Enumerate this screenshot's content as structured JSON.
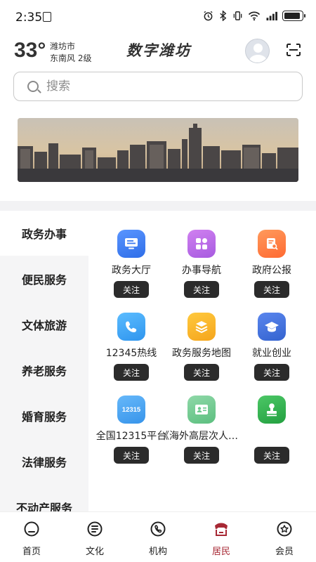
{
  "status_bar": {
    "time": "2:35"
  },
  "weather": {
    "temperature": "33°",
    "city": "潍坊市",
    "wind": "东南风  2级"
  },
  "app": {
    "title": "数字潍坊"
  },
  "search": {
    "placeholder": "搜索"
  },
  "sidebar": {
    "items": [
      {
        "label": "政务办事",
        "active": true
      },
      {
        "label": "便民服务"
      },
      {
        "label": "文体旅游"
      },
      {
        "label": "养老服务"
      },
      {
        "label": "婚育服务"
      },
      {
        "label": "法律服务"
      },
      {
        "label": "不动产服务"
      }
    ]
  },
  "services": [
    {
      "label": "政务大厅",
      "icon": "monitor-icon",
      "color": "#3d7cf0",
      "follow": "关注"
    },
    {
      "label": "办事导航",
      "icon": "apps-icon",
      "color": "#b768e6",
      "follow": "关注"
    },
    {
      "label": "政府公报",
      "icon": "document-search-icon",
      "color": "#ff7a3c",
      "follow": "关注"
    },
    {
      "label": "12345热线",
      "icon": "phone-icon",
      "color": "#39a4f5",
      "follow": "关注"
    },
    {
      "label": "政务服务地图",
      "icon": "layers-icon",
      "color": "#f7b52b",
      "follow": "关注"
    },
    {
      "label": "就业创业",
      "icon": "graduation-cap-icon",
      "color": "#3f6fd8",
      "follow": "关注"
    },
    {
      "label": "全国12315平台",
      "icon": "badge-12315-icon",
      "color": "#4aa7f0",
      "badge_text": "12315",
      "follow": "关注"
    },
    {
      "label": "《海外高层次人才》",
      "icon": "id-card-icon",
      "color": "#6cc98d",
      "follow": "关注"
    },
    {
      "label": "",
      "icon": "stamp-icon",
      "color": "#2fb04b",
      "follow": "关注"
    }
  ],
  "bottom_nav": {
    "items": [
      {
        "label": "首页",
        "icon": "home-icon"
      },
      {
        "label": "文化",
        "icon": "culture-icon"
      },
      {
        "label": "机构",
        "icon": "organization-icon"
      },
      {
        "label": "居民",
        "icon": "resident-icon",
        "active": true
      },
      {
        "label": "会员",
        "icon": "member-star-icon"
      }
    ],
    "accent": "#a72834"
  }
}
